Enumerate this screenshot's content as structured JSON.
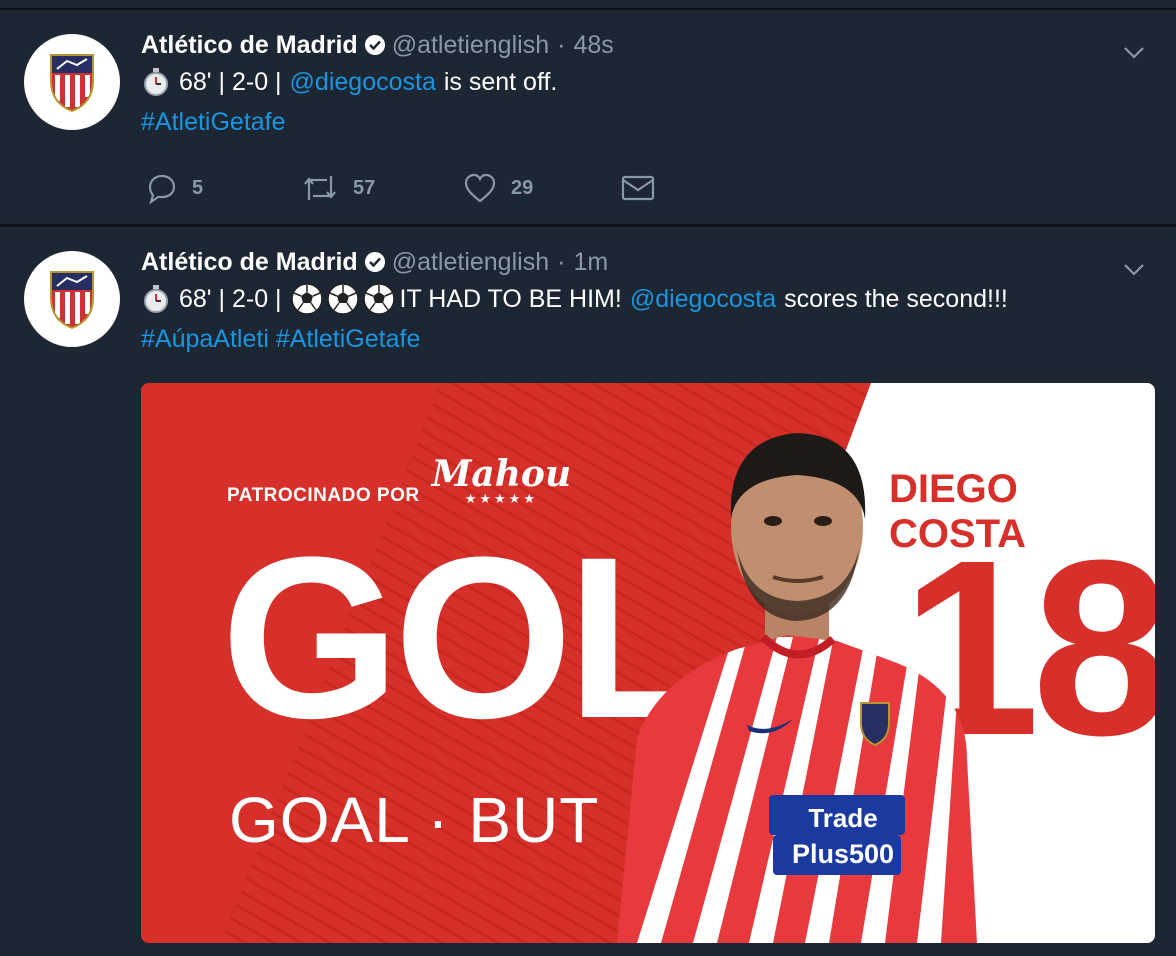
{
  "colors": {
    "background": "#1c2733",
    "text_primary": "#ffffff",
    "text_secondary": "#8899a6",
    "link": "#1b95e0",
    "atleti_red": "#d7302a"
  },
  "tweets": [
    {
      "author_name": "Atlético de Madrid",
      "handle": "@atletienglish",
      "separator": "·",
      "time": "48s",
      "line1_prefix": "68' | 2-0 |",
      "mention": "@diegocosta",
      "line1_suffix": "is sent off.",
      "hashtags": "#AtletiGetafe",
      "actions": {
        "replies": "5",
        "retweets": "57",
        "likes": "29"
      }
    },
    {
      "author_name": "Atlético de Madrid",
      "handle": "@atletienglish",
      "separator": "·",
      "time": "1m",
      "line1_prefix": "68' | 2-0 |",
      "line1_middle": "IT HAD TO BE HIM!",
      "mention": "@diegocosta",
      "line1_suffix": "scores the second!!!",
      "hashtags": "#AúpaAtleti #AtletiGetafe",
      "media": {
        "sponsor_label": "PATROCINADO POR",
        "brand": "Mahou",
        "brand_stars": "★★★★★",
        "headline": "GOL",
        "subline": "GOAL · BUT",
        "player_name": "DIEGO COSTA",
        "player_number": "18",
        "shirt_sponsor_line1": "Trade",
        "shirt_sponsor_line2": "Plus500"
      }
    }
  ],
  "icons": [
    "verified-badge-icon",
    "chevron-down-icon",
    "stopwatch-icon",
    "soccer-ball-icon",
    "reply-icon",
    "retweet-icon",
    "like-icon",
    "direct-message-icon",
    "atletico-crest-icon"
  ]
}
